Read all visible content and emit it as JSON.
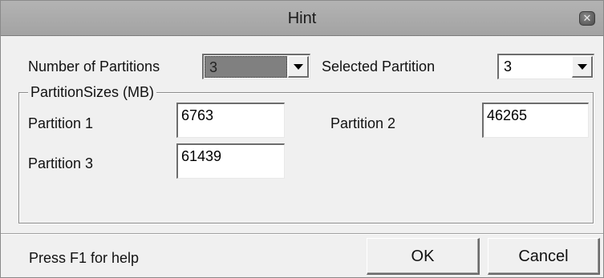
{
  "window": {
    "title": "Hint",
    "close_icon": "close-icon"
  },
  "top": {
    "num_partitions_label": "Number of Partitions",
    "num_partitions_value": "3",
    "selected_partition_label": "Selected Partition",
    "selected_partition_value": "3"
  },
  "group": {
    "legend": "PartitionSizes (MB)",
    "partitions": [
      {
        "label": "Partition 1",
        "value": "6763"
      },
      {
        "label": "Partition 2",
        "value": "46265"
      },
      {
        "label": "Partition 3",
        "value": "61439"
      }
    ]
  },
  "footer": {
    "help_text": "Press F1 for help",
    "ok_label": "OK",
    "cancel_label": "Cancel"
  },
  "icons": {
    "dropdown": "chevron-down-icon"
  }
}
